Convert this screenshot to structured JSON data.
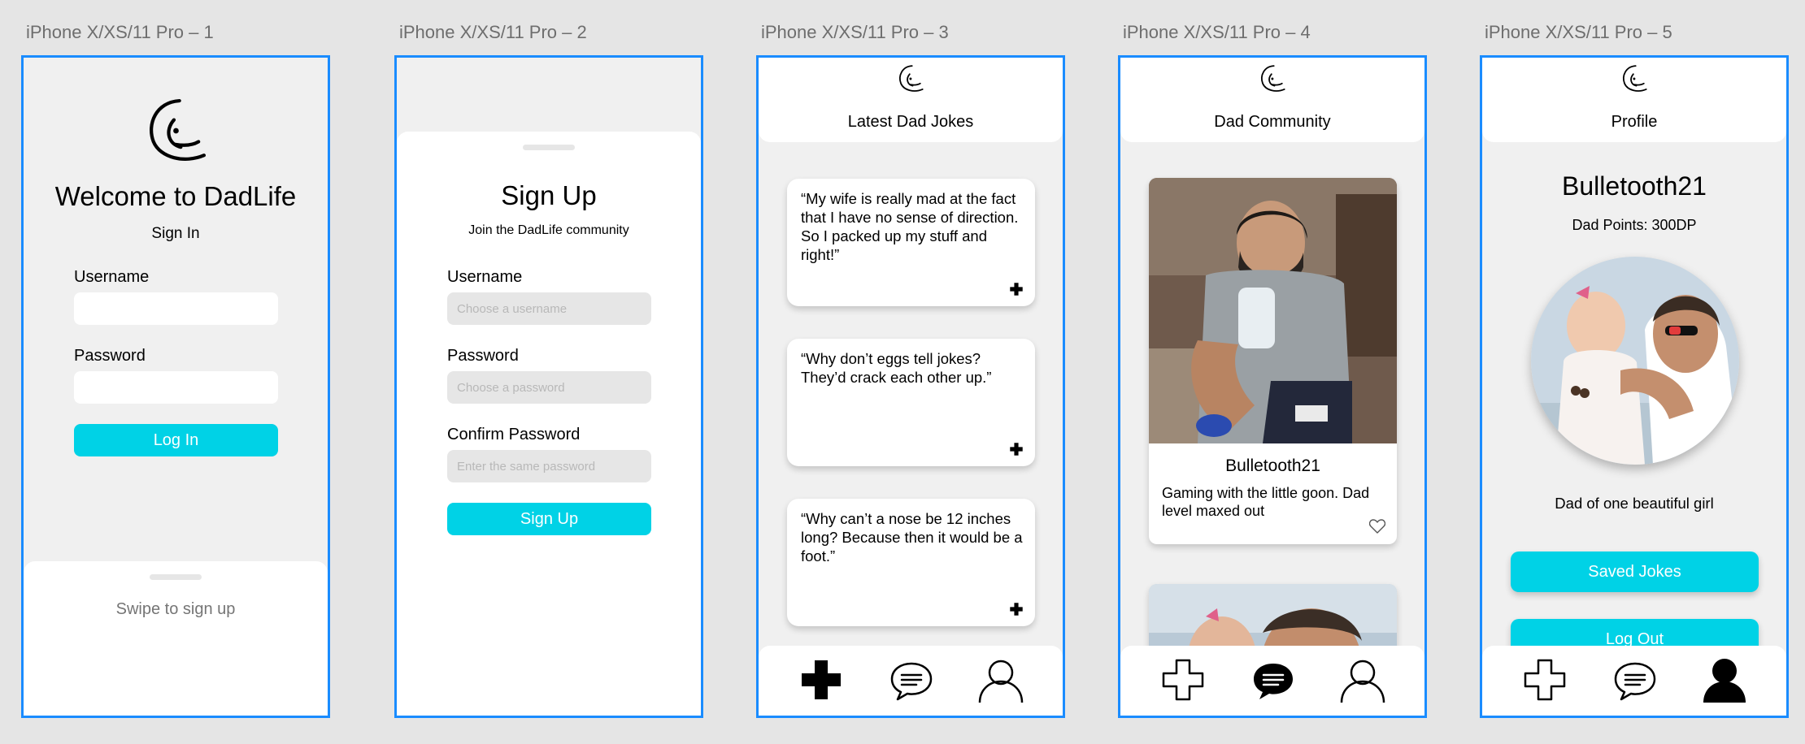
{
  "artboards": [
    {
      "label": "iPhone X/XS/11 Pro – 1"
    },
    {
      "label": "iPhone X/XS/11 Pro – 2"
    },
    {
      "label": "iPhone X/XS/11 Pro – 3"
    },
    {
      "label": "iPhone X/XS/11 Pro – 4"
    },
    {
      "label": "iPhone X/XS/11 Pro – 5"
    }
  ],
  "colors": {
    "accent": "#00d2e6",
    "frame": "#1a8cff",
    "screen_bg": "#f0f0f0",
    "card_bg": "#ffffff"
  },
  "signin": {
    "logo_icon": "dadlife-logo-icon",
    "title": "Welcome to DadLife",
    "subtitle": "Sign In",
    "username_label": "Username",
    "username_value": "",
    "password_label": "Password",
    "password_value": "",
    "login_button": "Log In",
    "swipe_text": "Swipe to sign up"
  },
  "signup": {
    "title": "Sign Up",
    "subtitle": "Join the DadLife community",
    "username_label": "Username",
    "username_placeholder": "Choose a username",
    "password_label": "Password",
    "password_placeholder": "Choose a password",
    "confirm_label": "Confirm Password",
    "confirm_placeholder": "Enter the same password",
    "signup_button": "Sign Up"
  },
  "jokes": {
    "header_title": "Latest Dad Jokes",
    "items": [
      {
        "text": "“My wife is really mad at the fact that I have no sense of direction. So I packed up my stuff and right!”"
      },
      {
        "text": "“Why don’t eggs tell jokes? They’d crack each other up.”"
      },
      {
        "text": "“Why can’t a nose be 12 inches long? Because then it would be a foot.”"
      }
    ]
  },
  "community": {
    "header_title": "Dad Community",
    "posts": [
      {
        "username": "Bulletooth21",
        "caption": "Gaming with the little goon. Dad level maxed out"
      }
    ]
  },
  "profile": {
    "header_title": "Profile",
    "username": "Bulletooth21",
    "points": "Dad Points: 300DP",
    "bio": "Dad of one beautiful girl",
    "saved_button": "Saved Jokes",
    "logout_button": "Log Out"
  },
  "tabbar": {
    "icons": [
      "plus-icon",
      "speech-bubble-icon",
      "person-icon"
    ],
    "active_by_screen": {
      "jokes": "plus-icon",
      "community": "speech-bubble-icon",
      "profile": "person-icon"
    }
  }
}
